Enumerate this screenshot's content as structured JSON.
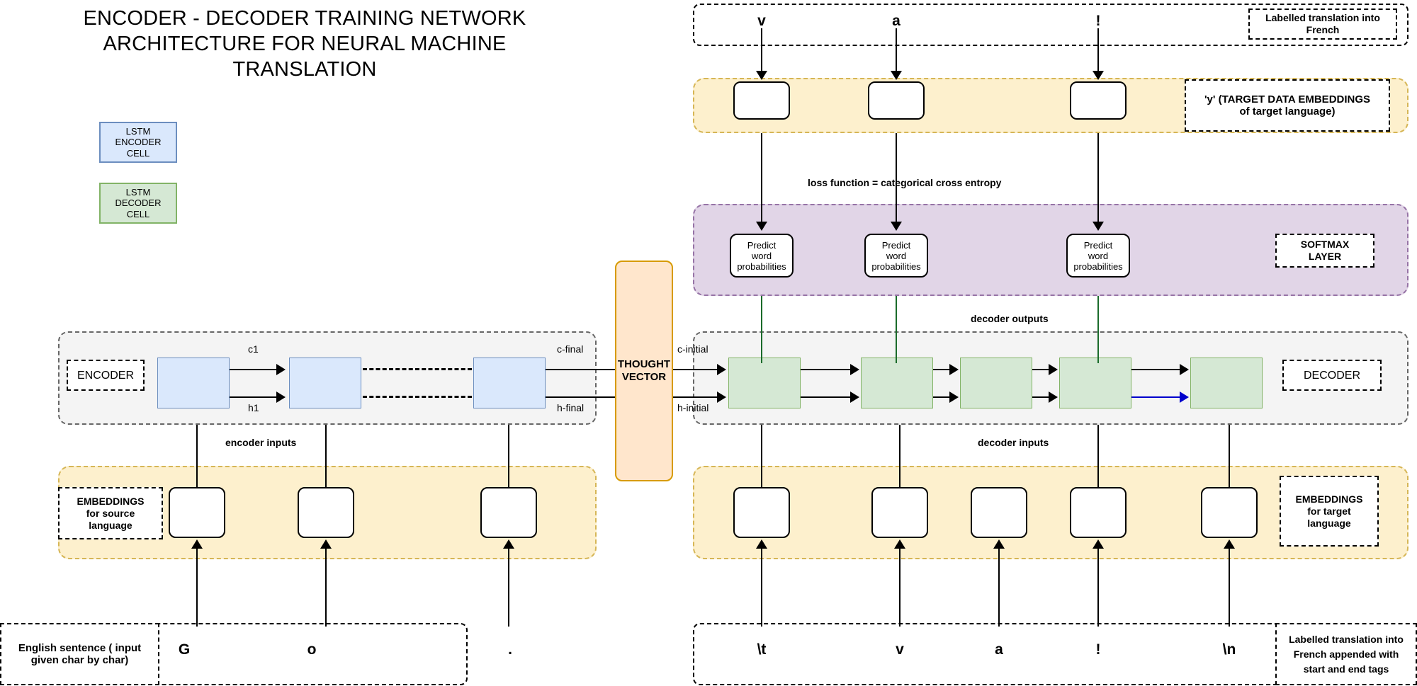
{
  "title": "ENCODER - DECODER TRAINING NETWORK ARCHITECTURE FOR NEURAL MACHINE TRANSLATION",
  "legend": {
    "encoder_cell": {
      "line1": "LSTM ENCODER",
      "line2": "CELL",
      "fill": "#dae8fc",
      "stroke": "#6c8ebf"
    },
    "decoder_cell": {
      "line1": "LSTM DECODER",
      "line2": "CELL",
      "fill": "#d5e8d4",
      "stroke": "#82b366"
    }
  },
  "encoder": {
    "region_label": "ENCODER",
    "inputs_label": "encoder inputs",
    "state_labels": {
      "c1": "c1",
      "h1": "h1",
      "c_final": "c-final",
      "h_final": "h-final"
    },
    "cells": [
      "",
      "",
      ""
    ]
  },
  "source_embeddings": {
    "label": "EMBEDDINGS for source language",
    "label_lines": [
      "EMBEDDINGS",
      "for source",
      "language"
    ],
    "boxes": [
      "",
      "",
      ""
    ]
  },
  "source_sentence": {
    "label_lines": [
      "English sentence ( input",
      "given char by char)"
    ],
    "chars": [
      "G",
      "o",
      "."
    ]
  },
  "thought_vector": {
    "line1": "THOUGHT",
    "line2": "VECTOR",
    "fill": "#ffe6cc",
    "stroke": "#d79b00"
  },
  "decoder": {
    "region_label": "DECODER",
    "inputs_label": "decoder inputs",
    "outputs_label": "decoder outputs",
    "state_labels": {
      "c_initial": "c-initial",
      "h_initial": "h-initial"
    },
    "cells": [
      "",
      "",
      "",
      "",
      ""
    ]
  },
  "target_embeddings_bottom": {
    "label_lines": [
      "EMBEDDINGS",
      "for target",
      "language"
    ],
    "boxes": [
      "",
      "",
      "",
      "",
      ""
    ]
  },
  "target_sentence_bottom": {
    "label_lines": [
      "Labelled translation into",
      "French appended with",
      "start and end tags"
    ],
    "chars": [
      "\\t",
      "v",
      "a",
      "!",
      "\\n"
    ]
  },
  "softmax": {
    "label_lines": [
      "SOFTMAX",
      "LAYER"
    ],
    "boxes": [
      {
        "lines": [
          "Predict",
          "word",
          "probabilities"
        ]
      },
      {
        "lines": [
          "Predict",
          "word",
          "probabilities"
        ]
      },
      {
        "lines": [
          "Predict",
          "word",
          "probabilities"
        ]
      }
    ],
    "fill": "#e1d5e7",
    "stroke": "#9673a6"
  },
  "loss_label": "loss function = categorical cross entropy",
  "target_embeddings_top": {
    "label_lines": [
      "'y' (TARGET DATA EMBEDDINGS",
      "of target language)"
    ],
    "boxes": [
      "",
      "",
      ""
    ]
  },
  "target_sentence_top": {
    "label_lines": [
      "Labelled translation into",
      "French"
    ],
    "chars": [
      "v",
      "a",
      "!"
    ]
  },
  "colors": {
    "encoder_fill": "#dae8fc",
    "decoder_fill": "#d5e8d4",
    "embedding_band": "#fdf0cd",
    "softmax_band": "#e1d5e7",
    "thought_fill": "#ffe6cc",
    "green_arrow": "#1a6b2a",
    "blue_arrow": "#0000cc"
  }
}
